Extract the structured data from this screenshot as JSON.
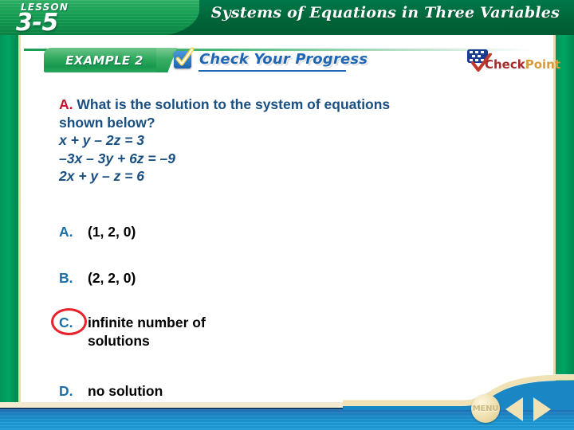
{
  "header": {
    "lesson_word": "LESSON",
    "lesson_number": "3-5",
    "title": "Systems of Equations in Three Variables"
  },
  "tab_row": {
    "example_label": "EXAMPLE 2",
    "check_icon_name": "checkbox-check-icon",
    "check_your_progress_label": "Check Your Progress",
    "checkpoint_logo": {
      "check_word": "Check",
      "point_word": "Point",
      "flag_icon_name": "flag-icon",
      "checkmark_icon_name": "checkmark-icon"
    }
  },
  "question": {
    "marker": "A.",
    "prompt_line1": " What is the solution to the system of equations",
    "prompt_line2": "shown below?",
    "equations": [
      {
        "lhs": "x + y – 2z",
        "eq": " = ",
        "rhs": "3"
      },
      {
        "lhs": "–3x – 3y + 6z",
        "eq": " = ",
        "rhs": "–9"
      },
      {
        "lhs": "2x + y – z",
        "eq": " = ",
        "rhs": "6"
      }
    ],
    "equations_plain": [
      "x + y – 2z = 3",
      "–3x – 3y + 6z = –9",
      "2x + y – z = 6"
    ]
  },
  "choices": [
    {
      "label": "A.",
      "text": "(1, 2, 0)",
      "selected": false
    },
    {
      "label": "B.",
      "text": "(2, 2, 0)",
      "selected": false
    },
    {
      "label": "C.",
      "text": "infinite number of\nsolutions",
      "selected": true
    },
    {
      "label": "D.",
      "text": "no solution",
      "selected": false
    }
  ],
  "correct_choice_marker_color": "#e8212b",
  "bottom_nav": {
    "menu_label": "MENU",
    "prev_icon_name": "previous-arrow-icon",
    "next_icon_name": "next-arrow-icon"
  },
  "colors": {
    "header_green": "#006B3C",
    "rail_green": "#00a463",
    "question_blue": "#1a4f82",
    "marker_red": "#c8102e",
    "choice_label_blue": "#1a6fa8",
    "progress_blue": "#1f66b5",
    "nav_blue": "#1a93cf",
    "cream": "#f3ead0"
  }
}
